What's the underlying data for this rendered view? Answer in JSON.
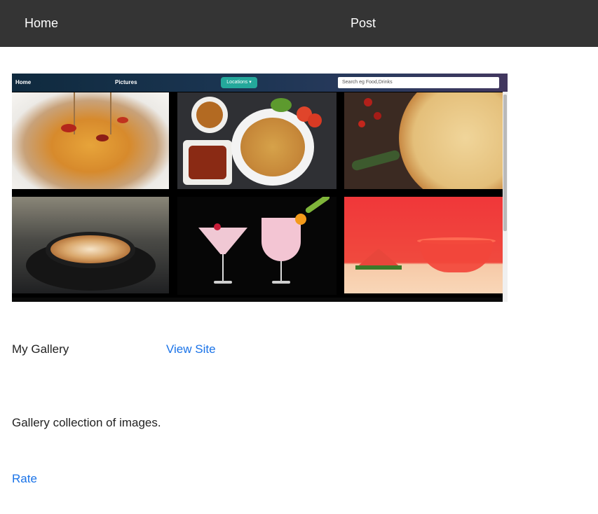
{
  "navbar": {
    "home_label": "Home",
    "post_label": "Post",
    "background": "#343434"
  },
  "preview": {
    "nav": {
      "home_label": "Home",
      "pictures_label": "Pictures",
      "locations_label": "Locations ▾",
      "search_placeholder": "Search eg Food,Drinks"
    },
    "tiles": [
      "pasta",
      "rice-plate",
      "pizza",
      "coffee",
      "cocktails",
      "watermelon"
    ]
  },
  "project": {
    "title": "My Gallery",
    "view_site_label": "View Site",
    "description": "Gallery collection of images.",
    "rate_label": "Rate",
    "link_color": "#1a73e8"
  }
}
